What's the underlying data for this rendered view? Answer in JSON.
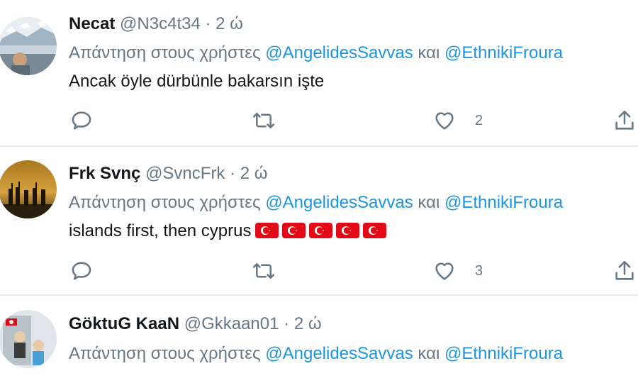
{
  "tweets": [
    {
      "name": "Necat",
      "handle": "@N3c4t34",
      "dot": " · ",
      "time": "2 ώ",
      "reply_prefix": "Απάντηση στους χρήστες ",
      "mention1": "@AngelidesSavvas",
      "conj": " και ",
      "mention2": "@EthnikiFroura",
      "text": "Ancak öyle dürbünle bakarsın işte",
      "like_count": "2"
    },
    {
      "name": "Frk Svnç",
      "handle": "@SvncFrk",
      "dot": " · ",
      "time": "2 ώ",
      "reply_prefix": "Απάντηση στους χρήστες ",
      "mention1": "@AngelidesSavvas",
      "conj": " και ",
      "mention2": "@EthnikiFroura",
      "text": "islands first, then cyprus",
      "flag_count": 5,
      "like_count": "3"
    },
    {
      "name": "GöktuG KaaN",
      "handle": "@Gkkaan01",
      "dot": " · ",
      "time": "2 ώ",
      "reply_prefix": "Απάντηση στους χρήστες ",
      "mention1": "@AngelidesSavvas",
      "conj": " και ",
      "mention2": "@EthnikiFroura"
    }
  ],
  "icons": {
    "reply": "reply-icon",
    "retweet": "retweet-icon",
    "like": "heart-icon",
    "share": "share-icon",
    "flag": "turkey-flag-emoji"
  },
  "colors": {
    "name": "#14171a",
    "secondary": "#657786",
    "mention": "#1b95e0",
    "divider": "#e6ecf0",
    "flag_red": "#e30a17"
  }
}
